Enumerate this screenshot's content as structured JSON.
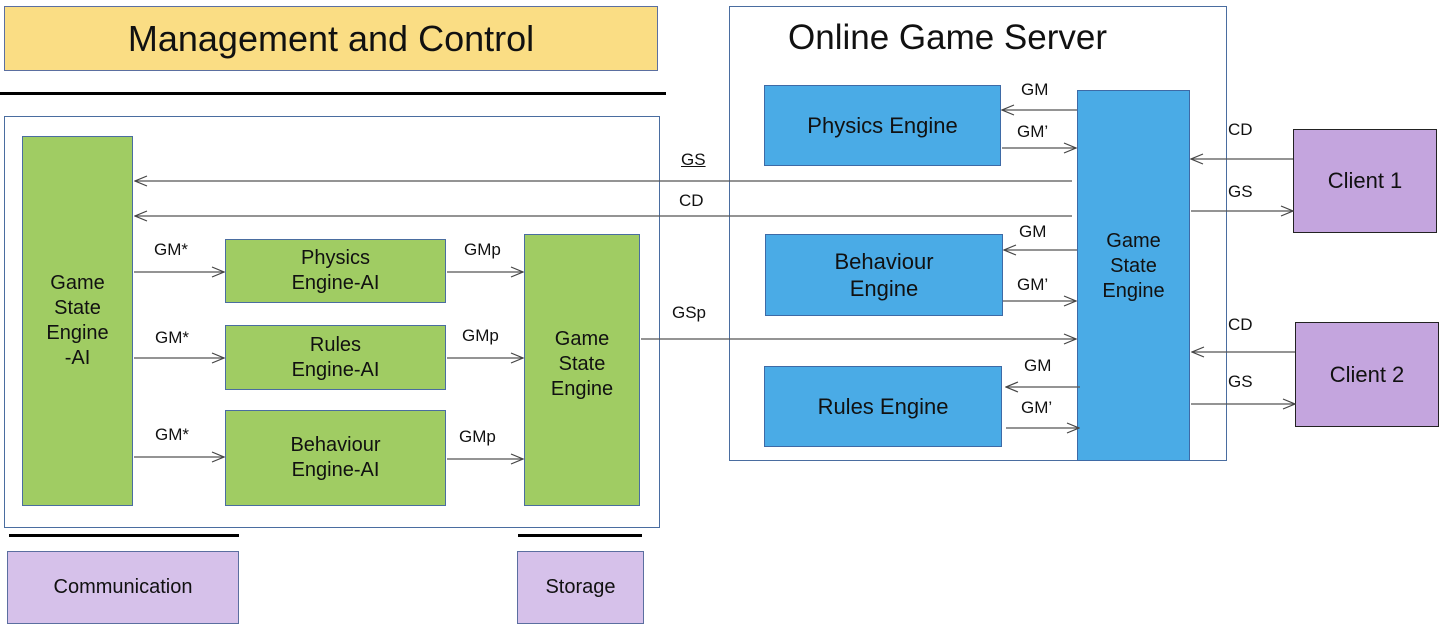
{
  "management": {
    "title": "Management and Control"
  },
  "server": {
    "title": "Online Game Server"
  },
  "ai_side": {
    "gse_ai": "Game\nState\nEngine\n-AI",
    "physics_ai": "Physics\nEngine-AI",
    "rules_ai": "Rules\nEngine-AI",
    "behaviour_ai": "Behaviour\nEngine-AI",
    "gse": "Game\nState\nEngine"
  },
  "server_side": {
    "physics": "Physics Engine",
    "behaviour": "Behaviour\nEngine",
    "rules": "Rules Engine",
    "gse": "Game\nState\nEngine"
  },
  "clients": [
    "Client 1",
    "Client 2"
  ],
  "bottom": {
    "communication": "Communication",
    "storage": "Storage"
  },
  "labels": {
    "gs": "GS",
    "cd": "CD",
    "gsp": "GSp",
    "gm_star": "GM*",
    "gmp": "GMp",
    "gm": "GM",
    "gm_prime": "GM’",
    "client_cd": "CD",
    "client_gs": "GS"
  },
  "colors": {
    "green": "#a0cc63",
    "blue": "#4aabe6",
    "yellow": "#fadd84",
    "purple": "#d6c1ea",
    "client_purple": "#c4a5de"
  }
}
